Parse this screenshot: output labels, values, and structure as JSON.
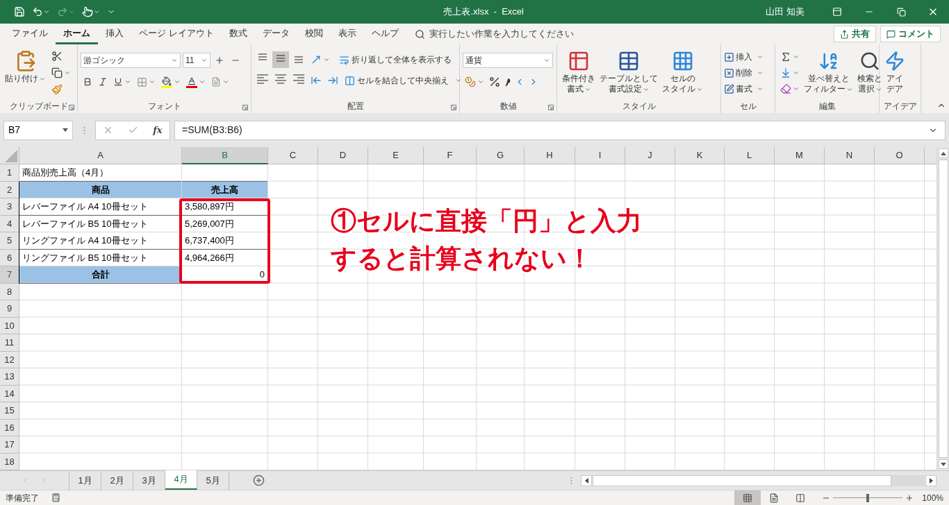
{
  "title_bar": {
    "title": "売上表.xlsx  -  Excel",
    "user": "山田 知美"
  },
  "menu_tabs": [
    {
      "label": "ファイル",
      "selected": false
    },
    {
      "label": "ホーム",
      "selected": true
    },
    {
      "label": "挿入",
      "selected": false
    },
    {
      "label": "ページ レイアウト",
      "selected": false
    },
    {
      "label": "数式",
      "selected": false
    },
    {
      "label": "データ",
      "selected": false
    },
    {
      "label": "校閲",
      "selected": false
    },
    {
      "label": "表示",
      "selected": false
    },
    {
      "label": "ヘルプ",
      "selected": false
    }
  ],
  "tell_me": {
    "placeholder": "実行したい作業を入力してください"
  },
  "share_button": "共有",
  "comment_button": "コメント",
  "ribbon": {
    "clipboard": {
      "label": "クリップボード",
      "paste": "貼り付け"
    },
    "font": {
      "label": "フォント",
      "font_name": "游ゴシック",
      "font_size": "11"
    },
    "alignment": {
      "label": "配置",
      "vertical": [
        {
          "kind": "top",
          "selected": false
        },
        {
          "kind": "middle",
          "selected": true
        },
        {
          "kind": "bottom",
          "selected": false
        }
      ],
      "wrap_text": "折り返して全体を表示する",
      "merge_center": "セルを結合して中央揃え"
    },
    "number": {
      "label": "数値",
      "format": "通貨"
    },
    "styles": {
      "label": "スタイル",
      "buttons": [
        {
          "kind": "conditional",
          "lines": [
            "条件付き",
            "書式"
          ]
        },
        {
          "kind": "table",
          "lines": [
            "テーブルとして",
            "書式設定"
          ]
        },
        {
          "kind": "cell_styles",
          "lines": [
            "セルの",
            "スタイル"
          ]
        }
      ]
    },
    "cells": {
      "label": "セル",
      "buttons": [
        {
          "kind": "insert",
          "label": "挿入"
        },
        {
          "kind": "delete",
          "label": "削除"
        },
        {
          "kind": "format",
          "label": "書式"
        }
      ]
    },
    "editing": {
      "label": "編集",
      "buttons": [
        {
          "kind": "sort",
          "lines": [
            "並べ替えと",
            "フィルター"
          ]
        },
        {
          "kind": "find",
          "lines": [
            "検索と",
            "選択"
          ]
        }
      ]
    },
    "ideas": {
      "label": "アイデア",
      "lines": [
        "アイ",
        "デア"
      ]
    }
  },
  "formula_bar": {
    "name_box": "B7",
    "function_button": "fx",
    "formula": "=SUM(B3:B6)"
  },
  "sheet": {
    "columns": [
      {
        "label": "A",
        "selected": false
      },
      {
        "label": "B",
        "selected": true
      },
      {
        "label": "C",
        "selected": false
      },
      {
        "label": "D",
        "selected": false
      },
      {
        "label": "E",
        "selected": false
      },
      {
        "label": "F",
        "selected": false
      },
      {
        "label": "G",
        "selected": false
      },
      {
        "label": "H",
        "selected": false
      },
      {
        "label": "I",
        "selected": false
      },
      {
        "label": "J",
        "selected": false
      },
      {
        "label": "K",
        "selected": false
      },
      {
        "label": "L",
        "selected": false
      },
      {
        "label": "M",
        "selected": false
      },
      {
        "label": "N",
        "selected": false
      },
      {
        "label": "O",
        "selected": false
      }
    ],
    "rows": [
      {
        "number": "1",
        "selected": false,
        "cells": [
          {
            "text": "商品別売上高（4月）",
            "kind": "plain"
          }
        ]
      },
      {
        "number": "2",
        "selected": false,
        "cells": [
          {
            "text": "商品",
            "kind": "header"
          },
          {
            "text": "売上高",
            "kind": "header"
          }
        ]
      },
      {
        "number": "3",
        "selected": false,
        "cells": [
          {
            "text": "レバーファイル A4 10冊セット",
            "kind": "text"
          },
          {
            "text": "3,580,897円",
            "kind": "text"
          }
        ]
      },
      {
        "number": "4",
        "selected": false,
        "cells": [
          {
            "text": "レバーファイル B5 10冊セット",
            "kind": "text"
          },
          {
            "text": "5,269,007円",
            "kind": "text"
          }
        ]
      },
      {
        "number": "5",
        "selected": false,
        "cells": [
          {
            "text": "リングファイル A4 10冊セット",
            "kind": "text"
          },
          {
            "text": "6,737,400円",
            "kind": "text"
          }
        ]
      },
      {
        "number": "6",
        "selected": false,
        "cells": [
          {
            "text": "リングファイル B5 10冊セット",
            "kind": "text"
          },
          {
            "text": "4,964,266円",
            "kind": "text"
          }
        ]
      },
      {
        "number": "7",
        "selected": true,
        "cells": [
          {
            "text": "合計",
            "kind": "header"
          },
          {
            "text": "0",
            "kind": "number"
          }
        ]
      },
      {
        "number": "8",
        "selected": false,
        "cells": []
      },
      {
        "number": "9",
        "selected": false,
        "cells": []
      },
      {
        "number": "10",
        "selected": false,
        "cells": []
      },
      {
        "number": "11",
        "selected": false,
        "cells": []
      },
      {
        "number": "12",
        "selected": false,
        "cells": []
      },
      {
        "number": "13",
        "selected": false,
        "cells": []
      },
      {
        "number": "14",
        "selected": false,
        "cells": []
      },
      {
        "number": "15",
        "selected": false,
        "cells": []
      },
      {
        "number": "16",
        "selected": false,
        "cells": []
      },
      {
        "number": "17",
        "selected": false,
        "cells": []
      },
      {
        "number": "18",
        "selected": false,
        "cells": []
      }
    ]
  },
  "annotation": {
    "lines": [
      "①セルに直接「円」と入力",
      "すると計算されない！"
    ]
  },
  "sheet_tabs": [
    {
      "label": "1月",
      "selected": false
    },
    {
      "label": "2月",
      "selected": false
    },
    {
      "label": "3月",
      "selected": false
    },
    {
      "label": "4月",
      "selected": true
    },
    {
      "label": "5月",
      "selected": false
    }
  ],
  "status_bar": {
    "status": "準備完了",
    "views": [
      {
        "kind": "normal",
        "selected": true
      },
      {
        "kind": "page_layout",
        "selected": false
      },
      {
        "kind": "page_break",
        "selected": false
      }
    ],
    "zoom": {
      "level": 0.5
    },
    "zoom_text": "100%"
  }
}
